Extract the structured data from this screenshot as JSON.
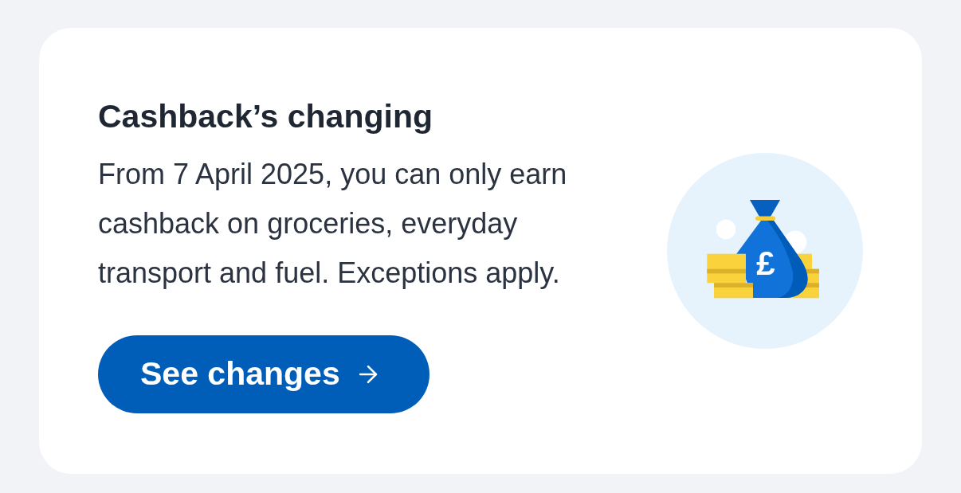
{
  "card": {
    "title": "Cashback’s changing",
    "body": "From 7 April 2025, you can only earn cashback on groceries, everyday transport and fuel. Exceptions apply.",
    "button": {
      "label": "See changes"
    },
    "illustration": {
      "symbol": "£"
    }
  }
}
